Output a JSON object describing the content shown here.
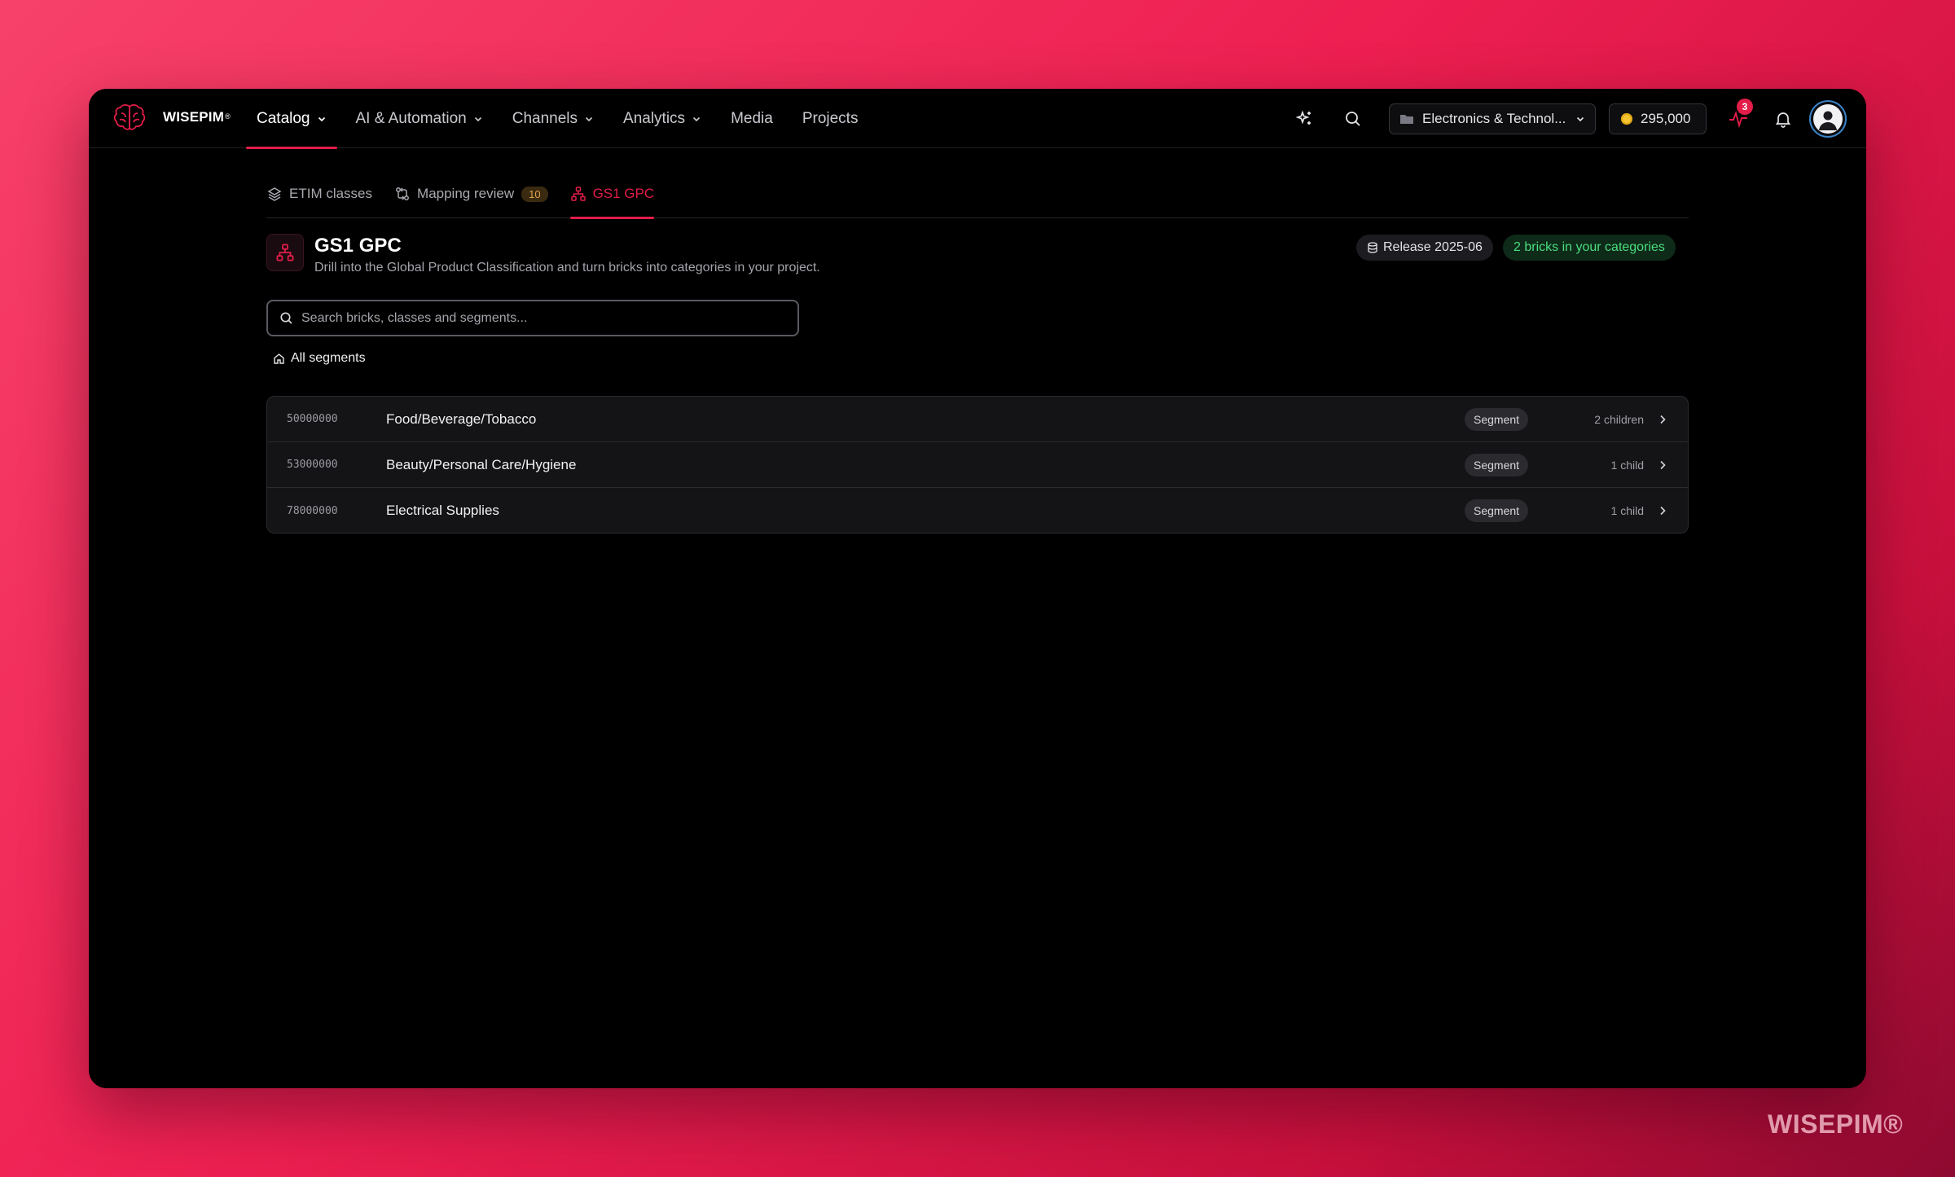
{
  "brand": {
    "name": "WISEPIM",
    "mark": "®"
  },
  "nav": [
    {
      "label": "Catalog",
      "dropdown": true,
      "active": true
    },
    {
      "label": "AI & Automation",
      "dropdown": true
    },
    {
      "label": "Channels",
      "dropdown": true
    },
    {
      "label": "Analytics",
      "dropdown": true
    },
    {
      "label": "Media",
      "dropdown": false
    },
    {
      "label": "Projects",
      "dropdown": false
    }
  ],
  "toolbar": {
    "workspace": "Electronics & Technol...",
    "credits": "295,000",
    "activity_count": "3"
  },
  "subtabs": {
    "etim": "ETIM classes",
    "mapping": "Mapping review",
    "mapping_count": "10",
    "gs1": "GS1 GPC"
  },
  "header": {
    "title": "GS1 GPC",
    "description": "Drill into the Global Product Classification and turn bricks into categories in your project.",
    "release": "Release 2025-06",
    "bricks": "2 bricks in your categories"
  },
  "search": {
    "placeholder": "Search bricks, classes and segments..."
  },
  "breadcrumb": "All segments",
  "rows": [
    {
      "code": "50000000",
      "name": "Food/Beverage/Tobacco",
      "type": "Segment",
      "children": "2 children"
    },
    {
      "code": "53000000",
      "name": "Beauty/Personal Care/Hygiene",
      "type": "Segment",
      "children": "1 child"
    },
    {
      "code": "78000000",
      "name": "Electrical Supplies",
      "type": "Segment",
      "children": "1 child"
    }
  ],
  "watermark": "WISEPIM®",
  "colors": {
    "accent": "#e11d48",
    "success": "#4ade80",
    "background": "#000000"
  }
}
